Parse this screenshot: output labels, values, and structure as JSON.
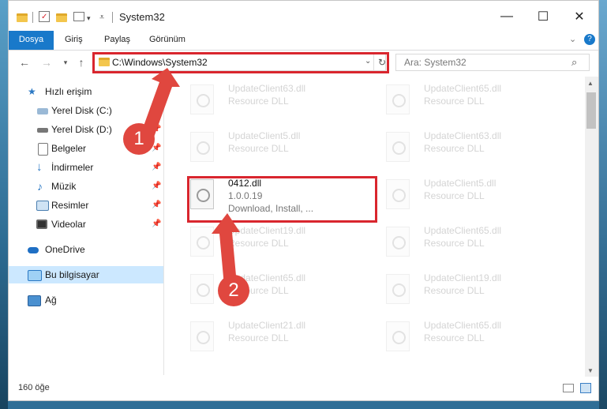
{
  "window": {
    "title": "System32"
  },
  "ribbon": {
    "tabs": [
      "Dosya",
      "Giriş",
      "Paylaş",
      "Görünüm"
    ]
  },
  "address": {
    "path": "C:\\Windows\\System32",
    "search_placeholder": "Ara: System32"
  },
  "sidebar": {
    "items": [
      {
        "label": "Hızlı erişim",
        "icon": "star-icon",
        "pinned": false
      },
      {
        "label": "Yerel Disk (C:)",
        "icon": "drive-icon",
        "pinned": true
      },
      {
        "label": "Yerel Disk (D:)",
        "icon": "drive-icon",
        "pinned": true
      },
      {
        "label": "Belgeler",
        "icon": "documents-icon",
        "pinned": true
      },
      {
        "label": "İndirmeler",
        "icon": "download-icon",
        "pinned": true
      },
      {
        "label": "Müzik",
        "icon": "music-icon",
        "pinned": true
      },
      {
        "label": "Resimler",
        "icon": "pictures-icon",
        "pinned": true
      },
      {
        "label": "Videolar",
        "icon": "videos-icon",
        "pinned": true
      },
      {
        "label": "OneDrive",
        "icon": "cloud-icon",
        "pinned": false
      },
      {
        "label": "Bu bilgisayar",
        "icon": "computer-icon",
        "pinned": false
      },
      {
        "label": "Ağ",
        "icon": "network-icon",
        "pinned": false
      }
    ]
  },
  "files": {
    "left": [
      {
        "name": "UpdateClient63.dll",
        "type": "Resource DLL"
      },
      {
        "name": "UpdateClient5.dll",
        "type": "Resource DLL"
      },
      {
        "name": "0412.dll",
        "version": "1.0.0.19",
        "desc": "Download, Install, ..."
      },
      {
        "name": "UpdateClient19.dll",
        "type": "Resource DLL"
      },
      {
        "name": "UpdateClient65.dll",
        "type": "Resource DLL"
      },
      {
        "name": "UpdateClient21.dll",
        "type": "Resource DLL"
      }
    ],
    "right": [
      {
        "name": "UpdateClient65.dll",
        "type": "Resource DLL"
      },
      {
        "name": "UpdateClient63.dll",
        "type": "Resource DLL"
      },
      {
        "name": "UpdateClient5.dll",
        "type": "Resource DLL"
      },
      {
        "name": "UpdateClient65.dll",
        "type": "Resource DLL"
      },
      {
        "name": "UpdateClient19.dll",
        "type": "Resource DLL"
      },
      {
        "name": "UpdateClient65.dll",
        "type": "Resource DLL"
      }
    ]
  },
  "status": {
    "count": "160 öğe"
  },
  "callouts": {
    "one": "1",
    "two": "2"
  },
  "colors": {
    "accent": "#1979ca",
    "highlight": "#d9262e",
    "badge": "#e0473f"
  }
}
